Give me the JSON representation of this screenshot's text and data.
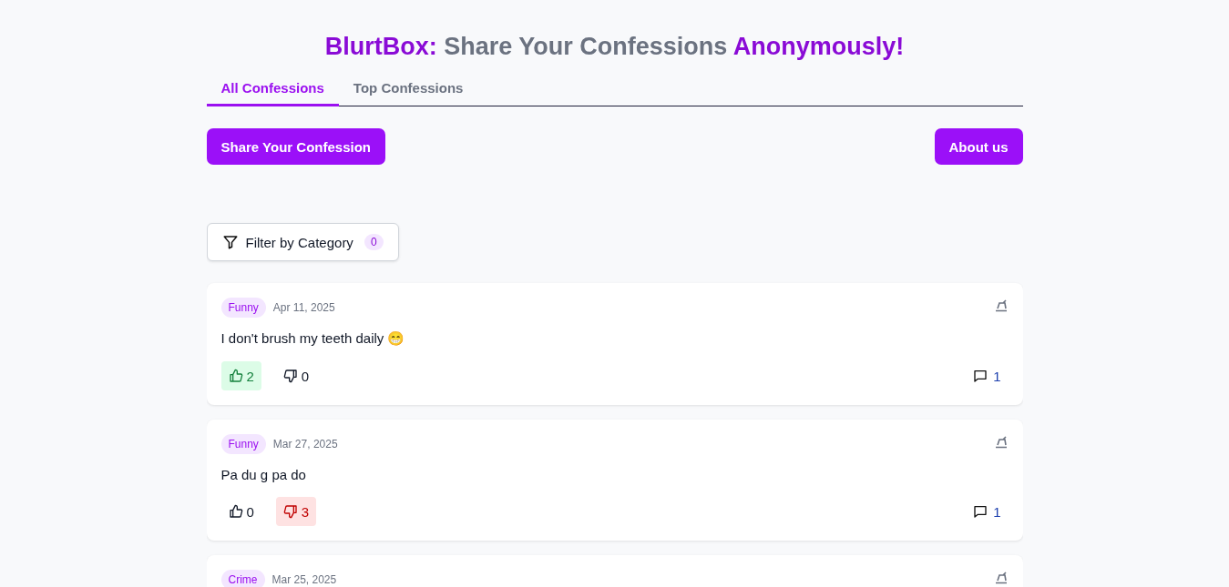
{
  "title": [
    {
      "text": "BlurtBox:",
      "accent": true
    },
    {
      "text": "Share Your Confessions",
      "accent": false
    },
    {
      "text": "Anonymously!",
      "accent": true
    }
  ],
  "tabs": [
    {
      "label": "All Confessions",
      "selected": true
    },
    {
      "label": "Top Confessions",
      "selected": false
    }
  ],
  "share_button": "Share Your Confession",
  "about_button": "About us",
  "filter": {
    "label": "Filter by Category",
    "count": "0"
  },
  "confessions": [
    {
      "category": "Funny",
      "date": "Apr 11, 2025",
      "text": "I don't brush my teeth daily 😁",
      "likes": {
        "count": "2",
        "selected": true
      },
      "dislikes": {
        "count": "0",
        "selected": false
      },
      "comments": "1"
    },
    {
      "category": "Funny",
      "date": "Mar 27, 2025",
      "text": "Pa du g pa do",
      "likes": {
        "count": "0",
        "selected": false
      },
      "dislikes": {
        "count": "3",
        "selected": true
      },
      "comments": "1"
    },
    {
      "category": "Crime",
      "date": "Mar 25, 2025"
    }
  ]
}
